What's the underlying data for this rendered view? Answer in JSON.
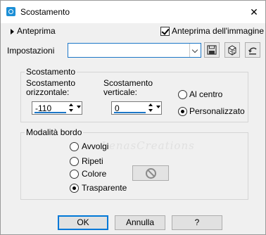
{
  "window": {
    "title": "Scostamento",
    "close_glyph": "✕"
  },
  "preview": {
    "toggle_label": "Anteprima",
    "checkbox_label": "Anteprima dell'immagine",
    "checked": true
  },
  "settings": {
    "label": "Impostazioni",
    "value": "",
    "tool_icons": [
      "save-icon",
      "load-preset-icon",
      "reset-icon"
    ]
  },
  "offset": {
    "group_label": "Scostamento",
    "horizontal": {
      "label_line1": "Scostamento",
      "label_line2": "orizzontale:",
      "value": "-110"
    },
    "vertical": {
      "label_line1": "Scostamento",
      "label_line2": "verticale:",
      "value": "0"
    },
    "center_label": "Al centro",
    "custom_label": "Personalizzato",
    "selected": "Personalizzato"
  },
  "edge_mode": {
    "group_label": "Modalità bordo",
    "options": [
      "Avvolgi",
      "Ripeti",
      "Colore",
      "Trasparente"
    ],
    "selected": "Trasparente"
  },
  "watermark": "LenasCreations",
  "buttons": {
    "ok": "OK",
    "cancel": "Annulla",
    "help": "?"
  },
  "colors": {
    "accent": "#1c77c7",
    "dialog_bg": "#f0f0f0"
  }
}
